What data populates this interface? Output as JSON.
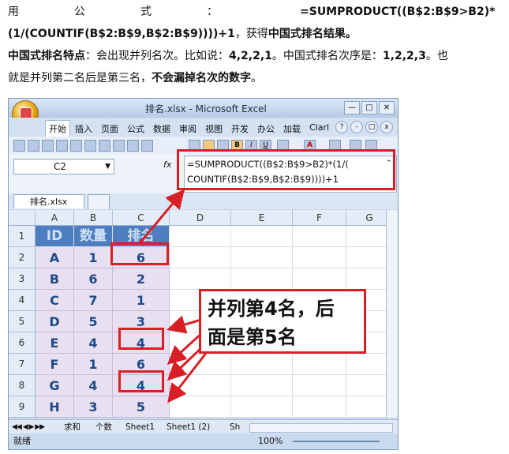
{
  "article": {
    "line1_prefix": "用　　　　　公　　　　　式　　　　　：",
    "line1_formula": "=SUMPRODUCT((B$2:B$9>B2)*",
    "line2_formula": "(1/(COUNTIF(B$2:B$9,B$2:B$9))))+1",
    "line2_mid": "，获得",
    "line2_bold": "中国式排名结果。",
    "line3_bold": "中国式排名特点",
    "line3_text": "：会出现并列名次。比如说：",
    "line3_seq": "4,2,2,1",
    "line3_text2": "。中国式排名次序是：",
    "line3_seq2": "1,2,2,3",
    "line3_end": "。也",
    "line4_text": "就是并列第二名后是第三名，",
    "line4_bold": "不会漏掉名次的数字",
    "line4_end": "。"
  },
  "window": {
    "title": "排名.xlsx - Microsoft Excel",
    "min": "—",
    "max": "□",
    "close": "✕"
  },
  "ribbon_tabs": [
    "开始",
    "插入",
    "页面",
    "公式",
    "数据",
    "审阅",
    "视图",
    "开发",
    "办公",
    "加载",
    "Clarl"
  ],
  "namebox": "C2",
  "fx": "fx",
  "formula_lines": [
    "=SUMPRODUCT((B$2:B$9>B2)*(1/(",
    "COUNTIF(B$2:B$9,B$2:B$9))))+1"
  ],
  "file_tab": "排名.xlsx",
  "columns": [
    "A",
    "B",
    "C",
    "D",
    "E",
    "F",
    "G"
  ],
  "rows": [
    "1",
    "2",
    "3",
    "4",
    "5",
    "6",
    "7",
    "8",
    "9"
  ],
  "table": {
    "headers": [
      "ID",
      "数量",
      "排名"
    ],
    "data": [
      [
        "A",
        "1",
        "6"
      ],
      [
        "B",
        "6",
        "2"
      ],
      [
        "C",
        "7",
        "1"
      ],
      [
        "D",
        "5",
        "3"
      ],
      [
        "E",
        "4",
        "4"
      ],
      [
        "F",
        "1",
        "6"
      ],
      [
        "G",
        "4",
        "4"
      ],
      [
        "H",
        "3",
        "5"
      ]
    ]
  },
  "callout": {
    "line1": "并列第4名，后",
    "line2": "面是第5名"
  },
  "sheet_tabs": [
    "求和",
    "个数",
    "Sheet1",
    "Sheet1 (2)",
    "Sh"
  ],
  "status": {
    "ready": "就绪",
    "zoom": "100%"
  },
  "colors": {
    "highlight": "#d81f26",
    "header_fill": "#4f7ec0",
    "data_fill": "#e8e0f0"
  }
}
